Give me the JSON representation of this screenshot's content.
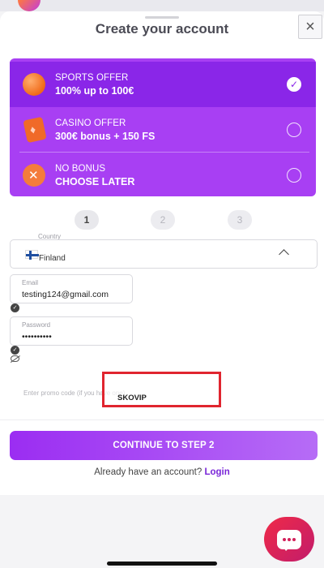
{
  "header": {
    "title": "Create your account",
    "close_symbol": "×"
  },
  "offers": [
    {
      "label": "SPORTS OFFER",
      "value": "100% up to 100€",
      "icon": "basketball-icon",
      "selected": true
    },
    {
      "label": "CASINO OFFER",
      "value": "300€ bonus + 150 FS",
      "icon": "playing-card-icon",
      "selected": false
    },
    {
      "label": "NO BONUS",
      "value": "CHOOSE LATER",
      "icon": "no-bonus-icon",
      "selected": false
    }
  ],
  "steps": [
    "1",
    "2",
    "3"
  ],
  "active_step": 1,
  "country": {
    "label": "Country",
    "value": "Finland",
    "flag": "finland-flag-icon"
  },
  "email": {
    "label": "Email",
    "value": "testing124@gmail.com"
  },
  "password": {
    "label": "Password",
    "value": "••••••••••"
  },
  "promo": {
    "placeholder": "Enter promo code (if you have one)",
    "value": "SKOVIP"
  },
  "continue_button": {
    "label": "CONTINUE TO STEP 2"
  },
  "login": {
    "prompt": "Already have an account?",
    "link": "Login"
  },
  "colors": {
    "accent": "#9b2df2",
    "offer_panel": "#a83ff3",
    "highlight_border": "#e0252f",
    "chat_button": "#ef2a48"
  }
}
